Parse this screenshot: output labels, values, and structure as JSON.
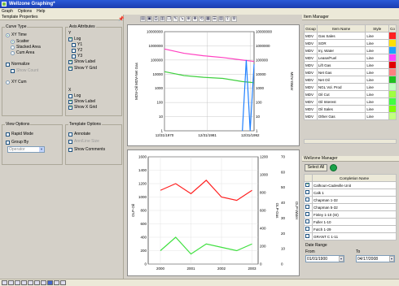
{
  "window": {
    "title": "Wellzone Graphing*"
  },
  "menu": [
    "Graph",
    "Options",
    "Help"
  ],
  "template_properties": {
    "title": "Template Properties",
    "curve_type": {
      "label": "Curve Type",
      "options": [
        "XY Time",
        "Scatter",
        "Stacked Area",
        "Cum Area",
        "Normalize",
        "Show Count",
        "XY Cum"
      ]
    },
    "axis_attributes": {
      "label": "Axis Attributes",
      "y_label": "Y",
      "y_items": [
        "Log",
        "Y1",
        "Y2",
        "Y3",
        "Show Label",
        "Show Y Grid"
      ],
      "x_label": "X",
      "x_items": [
        "Log",
        "Show Label",
        "Show X Grid"
      ]
    },
    "view_options": {
      "label": "View Options",
      "rapid_mode": "Rapid Mode",
      "group_by": "Group By",
      "group_by_value": "Operator"
    },
    "template_options": {
      "label": "Template Options",
      "annotate": "Annotate",
      "ann_line": "Ann/Line Size",
      "show_comments": "Show Comments"
    }
  },
  "item_manager": {
    "title": "Item Manager",
    "columns": [
      "Group",
      "Item Name",
      "Style",
      "Co"
    ],
    "rows": [
      {
        "group": "MDV",
        "name": "Gas Sales",
        "style": "Line",
        "color": "#ff2020"
      },
      {
        "group": "MDV",
        "name": "SOR",
        "style": "Line",
        "color": "#ffe000"
      },
      {
        "group": "MDV",
        "name": "Inj. Water",
        "style": "Line",
        "color": "#20a0ff"
      },
      {
        "group": "MDV",
        "name": "Lease/Fuel",
        "style": "Line",
        "color": "#ff40ff"
      },
      {
        "group": "MDV",
        "name": "Lift Gas",
        "style": "Line",
        "color": "#e00000"
      },
      {
        "group": "MDV",
        "name": "Net Gas",
        "style": "Line",
        "color": "#ff8080"
      },
      {
        "group": "MDV",
        "name": "Net Oil",
        "style": "Line",
        "color": "#20c020"
      },
      {
        "group": "MDV",
        "name": "NGL Vol. Prod",
        "style": "Line",
        "color": "#c0ffc0"
      },
      {
        "group": "MDV",
        "name": "Oil Cut",
        "style": "Line",
        "color": "#a0ff40"
      },
      {
        "group": "MDV",
        "name": "Oil Interest",
        "style": "Line",
        "color": "#40ff40"
      },
      {
        "group": "MDV",
        "name": "Oil Sales",
        "style": "Line",
        "color": "#80ff00"
      },
      {
        "group": "MDV",
        "name": "Other Gas",
        "style": "Line",
        "color": "#c0ff80"
      }
    ]
  },
  "wellzone_manager": {
    "title": "Wellzone Manager",
    "select_all": "Select All",
    "column": "Completion Name",
    "wells": [
      "Calhoun-Cadeville Unit",
      "Calk 1",
      "Chapman 1-32",
      "Chapman 5-32",
      "Finley 1-10 (SI)",
      "Fuller 1-10",
      "Futch 1-29",
      "GRANT C 1-11"
    ]
  },
  "date_range": {
    "label": "Date Range",
    "from_label": "From",
    "to_label": "To",
    "from": "01/01/1900",
    "to": "04/17/2008"
  },
  "chart_data": [
    {
      "type": "line",
      "y_scale": "log",
      "ylim": [
        1,
        10000000
      ],
      "yticks": [
        "10000000",
        "1000000",
        "100000",
        "10000",
        "1000",
        "100",
        "10",
        "1"
      ],
      "right_yticks": [
        "10000000",
        "1000000",
        "100000",
        "10000",
        "1000",
        "100",
        "10",
        "1"
      ],
      "xticks": [
        "12/31/1970",
        "12/31/1981",
        "12/31/1992"
      ],
      "ylabel": "MDV-Oil MDV-Net Gas",
      "y2label": "MDV-Water",
      "series": [
        {
          "name": "Net Gas",
          "color": "#ff40c0",
          "x": [
            1970,
            1975,
            1980,
            1985,
            1990,
            1993
          ],
          "y": [
            600000,
            300000,
            200000,
            150000,
            100000,
            80000
          ]
        },
        {
          "name": "Net Oil",
          "color": "#40d040",
          "x": [
            1970,
            1975,
            1980,
            1985,
            1990,
            1993
          ],
          "y": [
            15000,
            8000,
            6000,
            5000,
            3000,
            2500
          ]
        },
        {
          "name": "Inj. Water",
          "color": "#2080ff",
          "x": [
            1990,
            1991,
            1992,
            1993
          ],
          "y": [
            1,
            100000,
            1,
            50000
          ]
        }
      ]
    },
    {
      "type": "line",
      "xticks": [
        "2000",
        "2001",
        "2002",
        "2003"
      ],
      "yticks": [
        "1600",
        "1400",
        "1200",
        "1000",
        "800",
        "600",
        "400",
        "200",
        "0"
      ],
      "right_yticks": [
        "1200",
        "1000",
        "800",
        "600",
        "400",
        "200",
        "0"
      ],
      "right2_yticks": [
        "70",
        "60",
        "50",
        "40",
        "30",
        "20",
        "10",
        "0"
      ],
      "ylim": [
        0,
        1600
      ],
      "ylabel": "OLP-Oil",
      "y2label": "OLP-Gas",
      "y3label": "OLP-Water",
      "series": [
        {
          "name": "Gas",
          "color": "#ff2020",
          "x": [
            2000,
            2000.5,
            2001,
            2001.5,
            2002,
            2002.5,
            2003
          ],
          "y": [
            1100,
            1200,
            1050,
            1250,
            1000,
            950,
            1100
          ]
        },
        {
          "name": "Oil",
          "color": "#40e040",
          "x": [
            2000,
            2000.5,
            2001,
            2001.5,
            2002,
            2002.5,
            2003
          ],
          "y": [
            200,
            400,
            150,
            300,
            250,
            200,
            300
          ]
        }
      ]
    }
  ]
}
